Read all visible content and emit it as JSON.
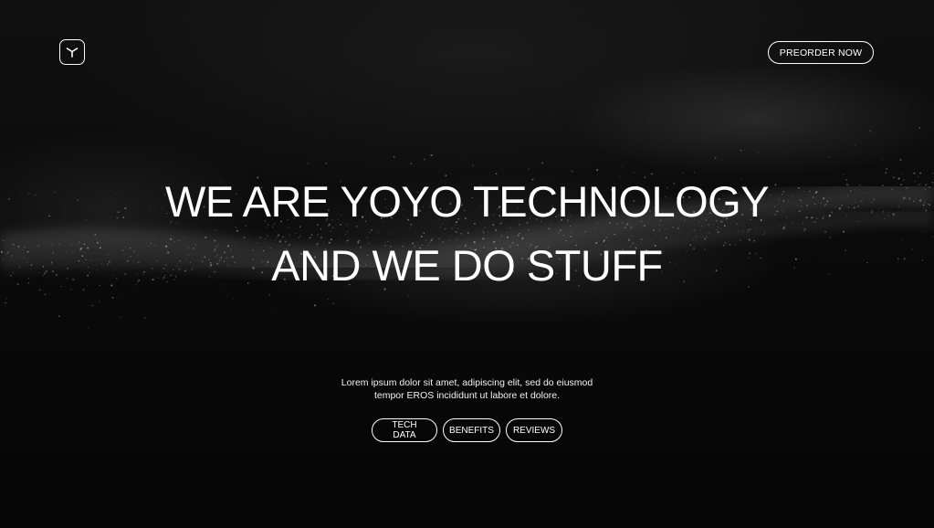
{
  "header": {
    "logo_icon": "yoyo-y-logo-icon",
    "preorder_label": "PREORDER NOW"
  },
  "hero": {
    "headline_line1": "WE ARE YOYO TECHNOLOGY",
    "headline_line2": "AND WE DO STUFF",
    "description_line1": "Lorem ipsum dolor sit amet, adipiscing elit, sed do eiusmod",
    "description_line2": "tempor  EROS incididunt ut labore et dolore."
  },
  "nav_chips": [
    {
      "label": "TECH DATA"
    },
    {
      "label": "BENEFITS"
    },
    {
      "label": "REVIEWS"
    }
  ],
  "colors": {
    "background": "#050505",
    "text": "#ffffff",
    "outline": "#ffffff"
  }
}
